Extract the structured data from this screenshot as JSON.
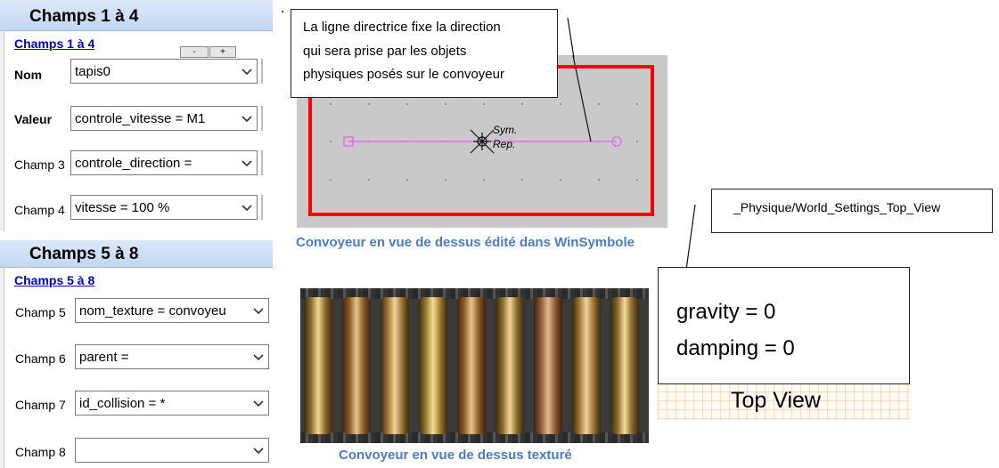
{
  "panel1": {
    "header": "Champs 1 à 4",
    "link": "Champs 1 à 4",
    "minus": "-",
    "plus": "+",
    "fields": [
      {
        "label": "Nom",
        "value": "tapis0"
      },
      {
        "label": "Valeur",
        "value": "controle_vitesse = M1"
      },
      {
        "label": "Champ 3",
        "value": "controle_direction ="
      },
      {
        "label": "Champ 4",
        "value": "vitesse = 100 %"
      }
    ]
  },
  "panel2": {
    "header": "Champs 5 à 8",
    "link": "Champs 5 à 8",
    "fields": [
      {
        "label": "Champ 5",
        "value": "nom_texture = convoyeu"
      },
      {
        "label": "Champ 6",
        "value": "parent ="
      },
      {
        "label": "Champ 7",
        "value": "id_collision = *"
      },
      {
        "label": "Champ 8",
        "value": ""
      }
    ]
  },
  "callout_direction": {
    "line1": "La ligne directrice fixe la direction",
    "line2": "qui sera prise par les objets",
    "line3": "physiques posés sur le convoyeur"
  },
  "symbol": {
    "sym": "Sym.",
    "rep": "Rep."
  },
  "caption_editor": "Convoyeur en vue de dessus édité dans WinSymbole",
  "caption_textured": "Convoyeur en vue de dessus texturé",
  "callout_world": "_Physique/World_Settings_Top_View",
  "world": {
    "gravity": "gravity = 0",
    "damping": "damping = 0",
    "title": "Top View"
  },
  "colors": {
    "border_red": "#ff0000",
    "director_line": "#e070e0",
    "caption": "#4a7cc4"
  }
}
